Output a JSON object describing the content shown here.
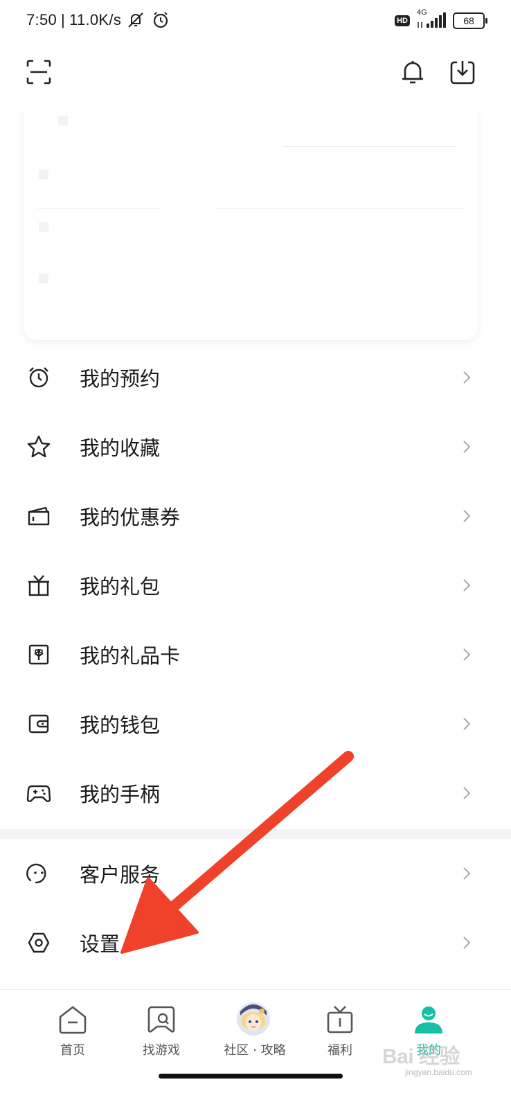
{
  "status_bar": {
    "time": "7:50",
    "separator": "|",
    "speed": "11.0K/s",
    "network": "4G",
    "hd": "HD",
    "battery": "68"
  },
  "header": {
    "scan_icon": "scan-icon",
    "bell_icon": "bell-icon",
    "download_icon": "download-icon"
  },
  "menu": {
    "items": [
      {
        "label": "我的预约",
        "icon": "alarm-clock-icon"
      },
      {
        "label": "我的收藏",
        "icon": "star-icon"
      },
      {
        "label": "我的优惠券",
        "icon": "coupon-icon"
      },
      {
        "label": "我的礼包",
        "icon": "gift-icon"
      },
      {
        "label": "我的礼品卡",
        "icon": "gift-card-icon"
      },
      {
        "label": "我的钱包",
        "icon": "wallet-icon"
      },
      {
        "label": "我的手柄",
        "icon": "gamepad-icon"
      }
    ],
    "items2": [
      {
        "label": "客户服务",
        "icon": "customer-service-icon"
      },
      {
        "label": "设置",
        "icon": "settings-icon"
      }
    ]
  },
  "bottom_nav": {
    "tabs": [
      {
        "label": "首页",
        "icon": "home-icon"
      },
      {
        "label": "找游戏",
        "icon": "game-search-icon"
      },
      {
        "label": "社区 · 攻略",
        "icon": "avatar"
      },
      {
        "label": "福利",
        "icon": "gift-box-icon"
      },
      {
        "label": "我的",
        "icon": "profile-icon"
      }
    ],
    "active_color": "#17bfa6"
  },
  "watermark": {
    "text": "Bai 经验",
    "sub": "jingyan.baidu.com"
  },
  "colors": {
    "accent": "#17bfa6",
    "arrow": "#f0412a"
  }
}
